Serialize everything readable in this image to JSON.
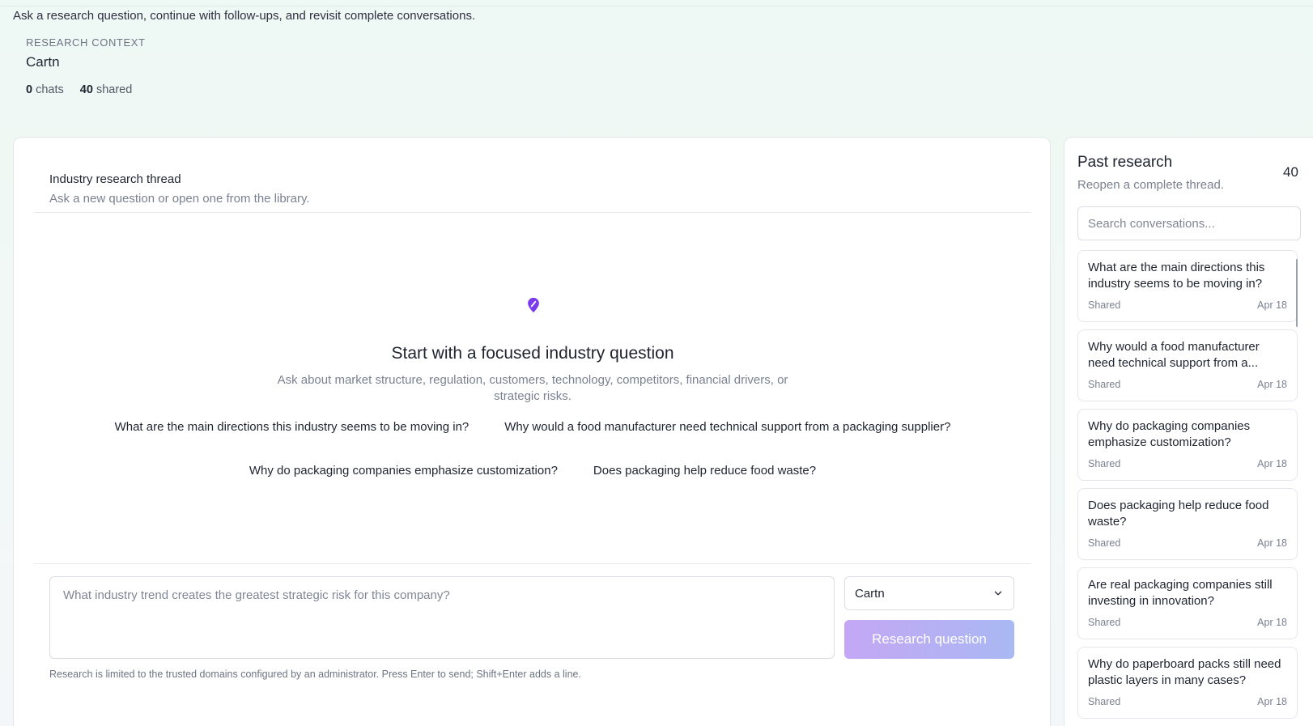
{
  "intro": "Ask a research question, continue with follow-ups, and revisit complete conversations.",
  "context": {
    "label": "RESEARCH CONTEXT",
    "name": "Cartn",
    "chats_count": "0",
    "chats_label": "chats",
    "shared_count": "40",
    "shared_label": "shared"
  },
  "thread": {
    "title": "Industry research thread",
    "subtitle": "Ask a new question or open one from the library."
  },
  "empty_state": {
    "icon": "pin-icon",
    "title": "Start with a focused industry question",
    "subtitle": "Ask about market structure, regulation, customers, technology, competitors, financial drivers, or strategic risks.",
    "suggestions": [
      "What are the main directions this industry seems to be moving in?",
      "Why would a food manufacturer need technical support from a packaging supplier?",
      "Why do packaging companies emphasize customization?",
      "Does packaging help reduce food waste?"
    ]
  },
  "composer": {
    "placeholder": "What industry trend creates the greatest strategic risk for this company?",
    "value": "",
    "company_select": "Cartn",
    "submit_label": "Research question",
    "footnote": "Research is limited to the trusted domains configured by an administrator. Press Enter to send; Shift+Enter adds a line."
  },
  "sidebar": {
    "title": "Past research",
    "count": "40",
    "subtitle": "Reopen a complete thread.",
    "search_placeholder": "Search conversations...",
    "conversations": [
      {
        "question": "What are the main directions this industry seems to be moving in?",
        "status": "Shared",
        "date": "Apr 18"
      },
      {
        "question": "Why would a food manufacturer need technical support from a...",
        "status": "Shared",
        "date": "Apr 18"
      },
      {
        "question": "Why do packaging companies emphasize customization?",
        "status": "Shared",
        "date": "Apr 18"
      },
      {
        "question": "Does packaging help reduce food waste?",
        "status": "Shared",
        "date": "Apr 18"
      },
      {
        "question": "Are real packaging companies still investing in innovation?",
        "status": "Shared",
        "date": "Apr 18"
      },
      {
        "question": "Why do paperboard packs still need plastic layers in many cases?",
        "status": "Shared",
        "date": "Apr 18"
      }
    ]
  },
  "colors": {
    "accent": "#7c3aed",
    "button_gradient_start": "#c4a7f5",
    "button_gradient_end": "#a9b8f3"
  }
}
